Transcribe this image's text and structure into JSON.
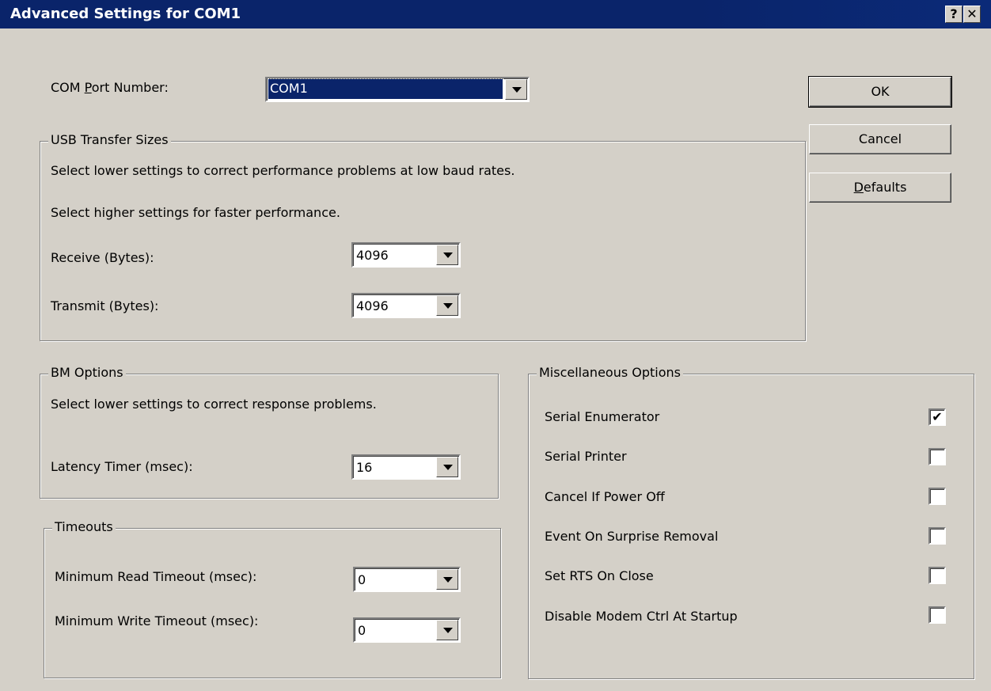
{
  "window": {
    "title": "Advanced Settings for COM1",
    "help_button": "?",
    "close_button": "✕"
  },
  "com_port": {
    "label": "COM Port Number:",
    "label_access_key": "P",
    "value": "COM1"
  },
  "buttons": {
    "ok": "OK",
    "cancel": "Cancel",
    "defaults": "Defaults",
    "defaults_access_key": "D"
  },
  "usb_transfer": {
    "legend": "USB Transfer Sizes",
    "desc1": "Select lower settings to correct performance problems at low baud rates.",
    "desc2": "Select higher settings for faster performance.",
    "receive_label": "Receive (Bytes):",
    "receive_value": "4096",
    "transmit_label": "Transmit (Bytes):",
    "transmit_value": "4096"
  },
  "bm_options": {
    "legend": "BM Options",
    "desc": "Select lower settings to correct response problems.",
    "latency_label": "Latency Timer (msec):",
    "latency_value": "16"
  },
  "timeouts": {
    "legend": "Timeouts",
    "min_read_label": "Minimum Read Timeout (msec):",
    "min_read_value": "0",
    "min_write_label": "Minimum Write Timeout (msec):",
    "min_write_value": "0"
  },
  "misc": {
    "legend": "Miscellaneous Options",
    "options": [
      {
        "label": "Serial Enumerator",
        "checked": true,
        "mark": "✔"
      },
      {
        "label": "Serial Printer",
        "checked": false,
        "mark": ""
      },
      {
        "label": "Cancel If Power Off",
        "checked": false,
        "mark": ""
      },
      {
        "label": "Event On Surprise Removal",
        "checked": false,
        "mark": ""
      },
      {
        "label": "Set RTS On Close",
        "checked": false,
        "mark": ""
      },
      {
        "label": "Disable Modem Ctrl At Startup",
        "checked": false,
        "mark": ""
      }
    ]
  }
}
